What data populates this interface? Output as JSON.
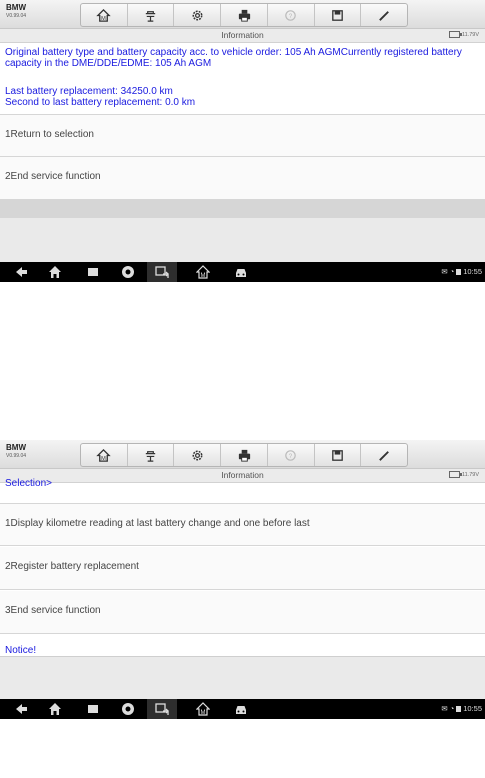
{
  "screens": [
    {
      "app": {
        "brand": "BMW",
        "version": "V0.99.04"
      },
      "info": {
        "title": "Information",
        "voltage": "11.79V"
      },
      "message": {
        "line1": "Original battery type and battery capacity acc. to vehicle order: 105 Ah AGMCurrently registered battery capacity in the DME/DDE/EDME: 105 Ah AGM",
        "line2": "Last battery replacement: 34250.0 km",
        "line3": "Second to last battery replacement: 0.0 km"
      },
      "options": [
        "1Return to selection",
        "2End service function"
      ],
      "status": {
        "time": "10:55"
      }
    },
    {
      "app": {
        "brand": "BMW",
        "version": "V0.99.04"
      },
      "info": {
        "title": "Information",
        "voltage": "11.79V"
      },
      "header_text": "Selection>",
      "options": [
        "1Display kilometre reading at last battery change and one before last",
        "2Register battery replacement",
        "3End service function"
      ],
      "notice": "Notice!",
      "status": {
        "time": "10:55"
      }
    }
  ],
  "toolbar_icons": [
    "home-icon",
    "vehicle-lift-icon",
    "settings-icon",
    "print-icon",
    "help-icon",
    "save-icon",
    "edit-icon"
  ],
  "nav_icons": [
    "back-icon",
    "home-icon",
    "recent-apps-icon",
    "chrome-icon",
    "screen-capture-icon",
    "diagnostics-icon",
    "car-icon"
  ],
  "colors": {
    "message_blue": "#1a1adf",
    "nav_black": "#000000"
  }
}
